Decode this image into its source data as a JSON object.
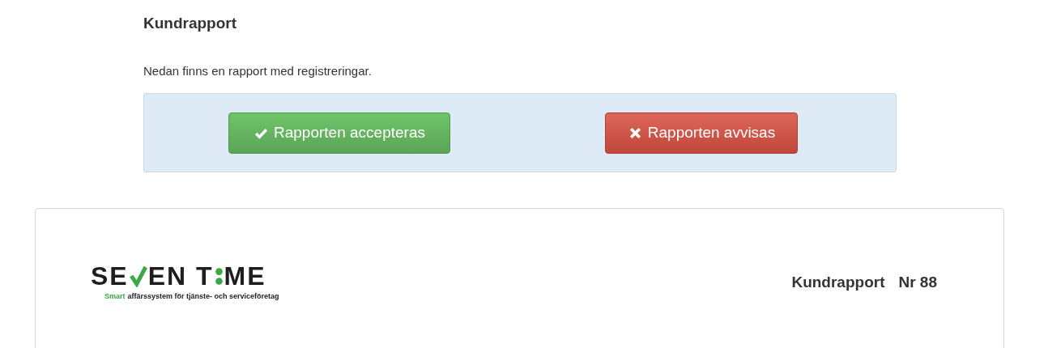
{
  "title": "Kundrapport",
  "intro": "Nedan finns en rapport med registreringar.",
  "actions": [
    {
      "kind": "accept",
      "label": "Rapporten accepteras"
    },
    {
      "kind": "reject",
      "label": "Rapporten avvisas"
    }
  ],
  "report": {
    "logo": {
      "part_1": "SE",
      "part_2": "EN T",
      "part_3": "ME",
      "tagline_highlight": "Smart",
      "tagline_rest": "affärssystem för tjänste- och serviceföretag"
    },
    "title": "Kundrapport",
    "number": "Nr 88"
  }
}
